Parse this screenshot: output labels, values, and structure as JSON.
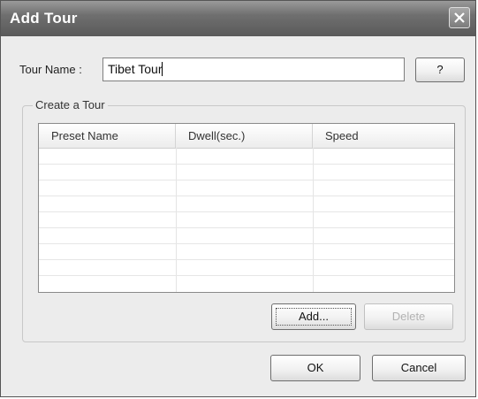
{
  "window": {
    "title": "Add Tour"
  },
  "form": {
    "tour_name_label": "Tour Name :",
    "tour_name_value": "Tibet Tour",
    "help_button_label": "?"
  },
  "group": {
    "legend": "Create a Tour",
    "columns": [
      "Preset Name",
      "Dwell(sec.)",
      "Speed"
    ],
    "rows": [],
    "add_button_label": "Add...",
    "delete_button_label": "Delete"
  },
  "dialog_buttons": {
    "ok_label": "OK",
    "cancel_label": "Cancel"
  }
}
